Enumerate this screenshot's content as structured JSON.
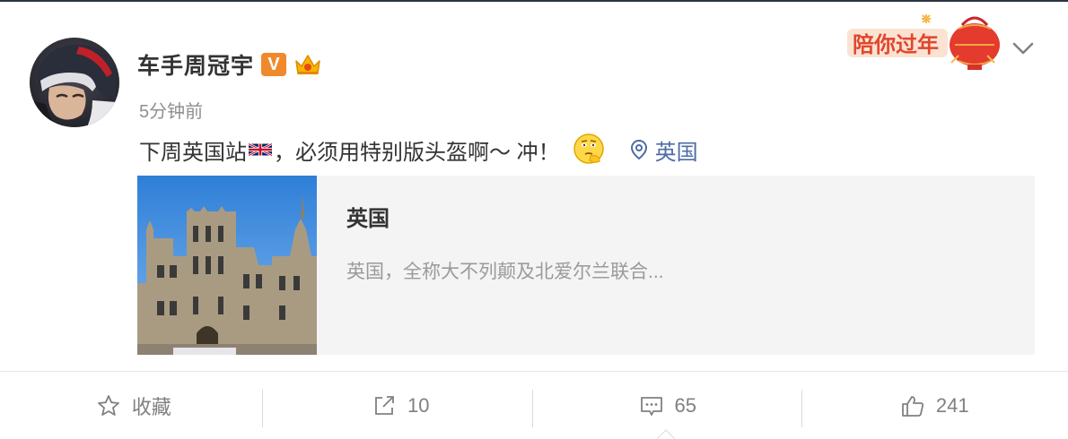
{
  "post": {
    "author": "车手周冠宇",
    "badge_v": "V",
    "time": "5分钟前",
    "text_before_flag": "下周英国站",
    "text_after_flag": "，必须用特别版头盔啊～ 冲！",
    "flag_icon": "uk-flag-icon",
    "emoji_icon": "thinking-face-emoji",
    "location": "英国",
    "link_card": {
      "title": "英国",
      "description": "英国，全称大不列颠及北爱尔兰联合..."
    },
    "festival_badge": "陪你过年"
  },
  "actions": {
    "favorite_label": "收藏",
    "repost_count": "10",
    "comment_count": "65",
    "like_count": "241"
  },
  "colors": {
    "link_blue": "#4e6ca4",
    "badge_orange": "#f0892c",
    "muted_gray": "#8f8f8f"
  }
}
